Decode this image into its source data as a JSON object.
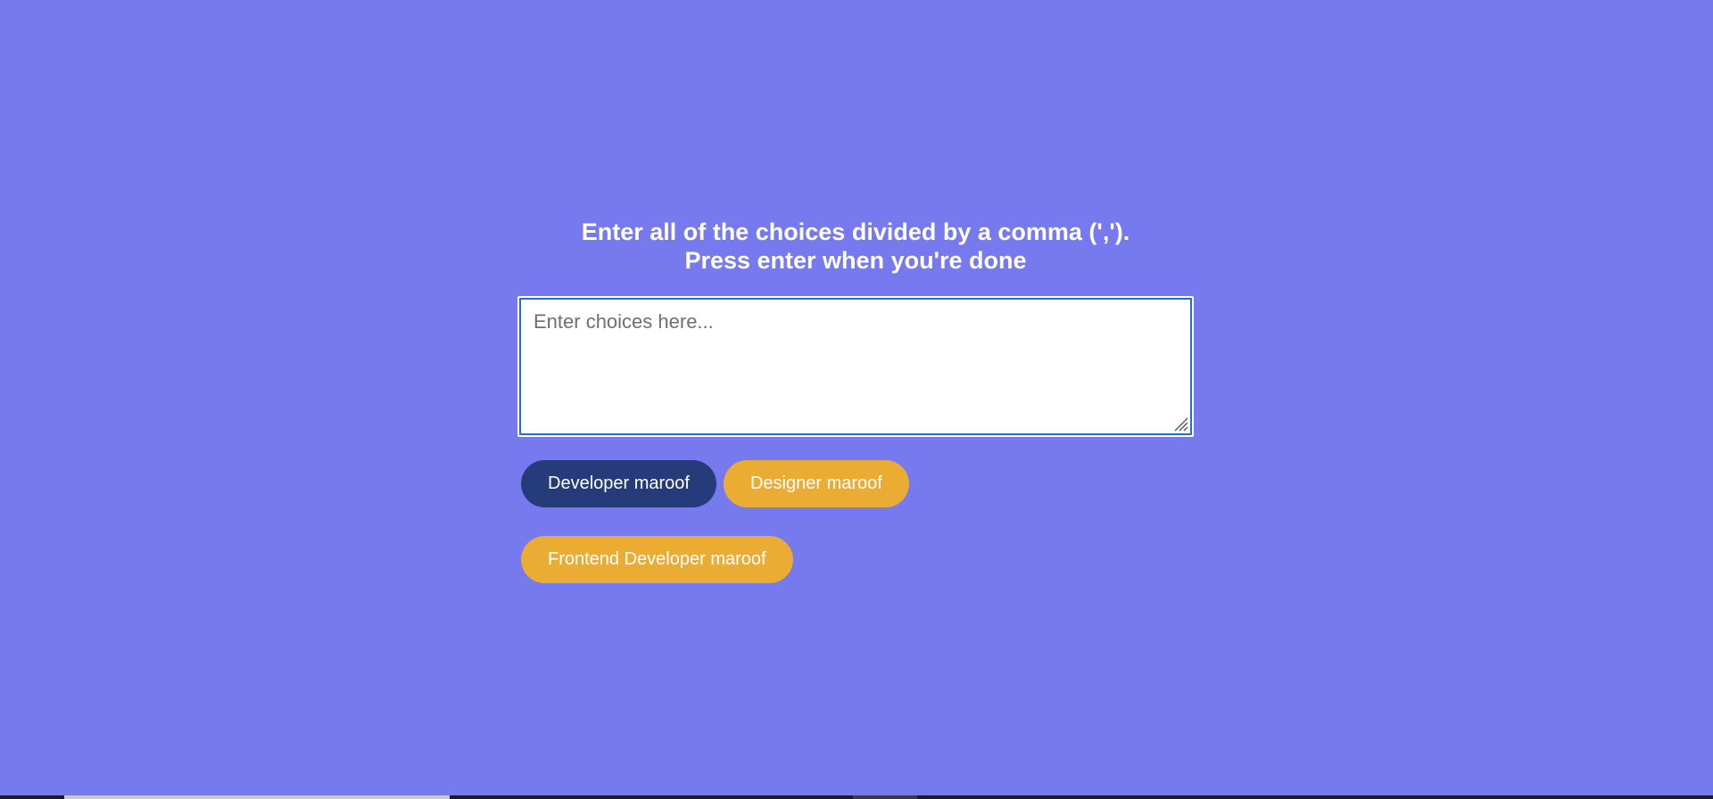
{
  "heading": {
    "line1": "Enter all of the choices divided by a comma (',').",
    "line2": "Press enter when you're done"
  },
  "textarea": {
    "placeholder": "Enter choices here...",
    "value": ""
  },
  "choices": [
    {
      "label": "Developer maroof",
      "state": "selected"
    },
    {
      "label": "Designer maroof",
      "state": "normal"
    },
    {
      "label": "Frontend Developer maroof",
      "state": "normal"
    }
  ],
  "colors": {
    "background": "#7779ef",
    "selected_tag": "#263c7a",
    "normal_tag": "#ebac33",
    "textarea_focus_border": "#1a6fd6"
  }
}
